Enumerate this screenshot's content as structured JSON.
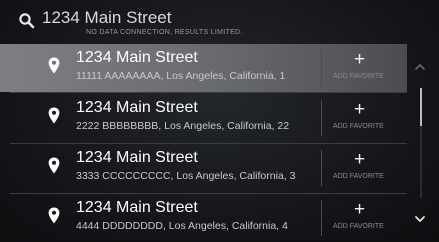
{
  "search": {
    "query": "1234 Main Street",
    "notice": "NO DATA CONNECTION, RESULTS LIMITED."
  },
  "results": [
    {
      "title": "1234 Main Street",
      "address": "11111 AAAAAAAA, Los Angeles, California, 1",
      "fav_label": "ADD FAVORITE",
      "selected": true
    },
    {
      "title": "1234 Main Street",
      "address": "2222 BBBBBBBB, Los Angeles, California, 22",
      "fav_label": "ADD FAVORITE",
      "selected": false
    },
    {
      "title": "1234 Main Street",
      "address": "3333 CCCCCCCCC, Los Angeles, California, 3",
      "fav_label": "ADD FAVORITE",
      "selected": false
    },
    {
      "title": "1234 Main Street",
      "address": "4444 DDDDDDDD, Los Angeles, California, 4",
      "fav_label": "ADD FAVORITE",
      "selected": false
    }
  ],
  "icons": {
    "search": "search-icon",
    "pin": "map-pin-icon",
    "add": "plus-icon",
    "up": "chevron-up-icon",
    "down": "chevron-down-icon"
  },
  "colors": {
    "selected_row": "#6c6e73",
    "background": "#141518",
    "text": "#ffffff"
  }
}
